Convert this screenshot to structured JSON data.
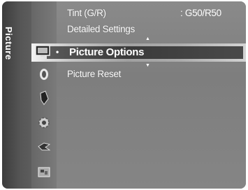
{
  "sidebar": {
    "label": "Picture"
  },
  "menu": {
    "items": [
      {
        "label": "Tint (G/R)",
        "value": ": G50/R50"
      },
      {
        "label": "Detailed Settings"
      },
      {
        "label": "Picture Options",
        "selected": true
      },
      {
        "label": "Picture Reset"
      }
    ]
  },
  "icons": [
    "picture-icon",
    "sound-icon",
    "channel-icon",
    "setup-icon",
    "input-icon",
    "application-icon"
  ],
  "colors": {
    "background": "#808080",
    "text": "#ffffff",
    "highlight": "#ffffff"
  }
}
